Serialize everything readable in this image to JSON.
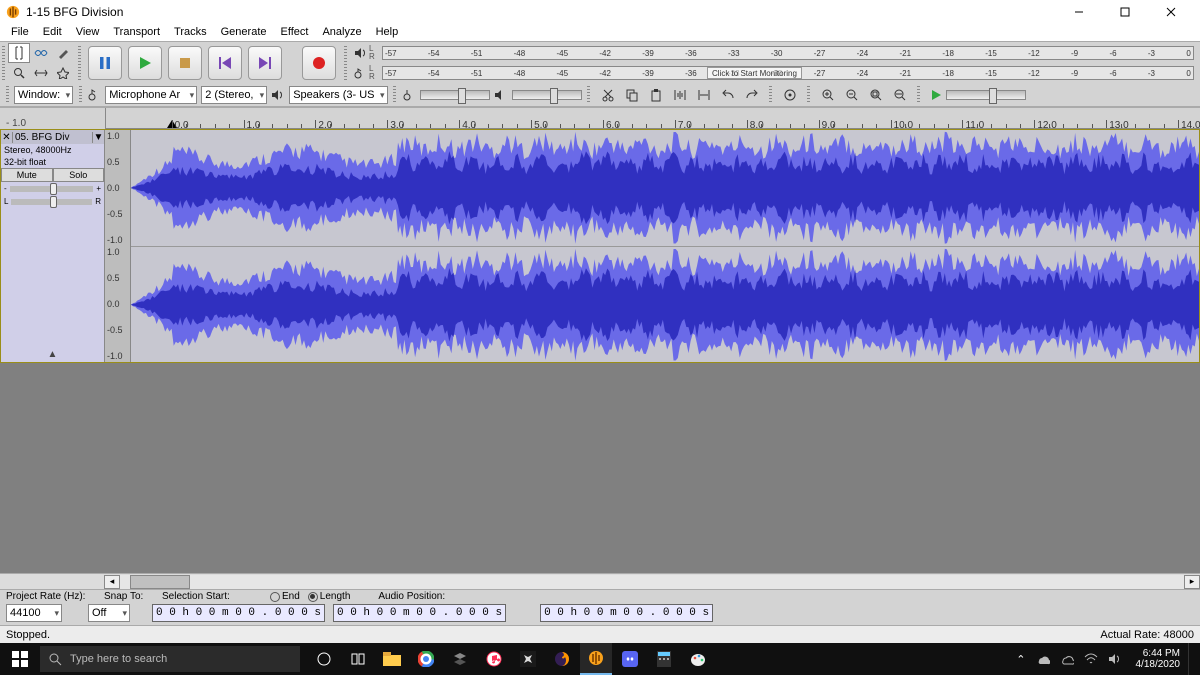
{
  "window": {
    "title": "1-15 BFG Division"
  },
  "menu": [
    "File",
    "Edit",
    "View",
    "Transport",
    "Tracks",
    "Generate",
    "Effect",
    "Analyze",
    "Help"
  ],
  "meter": {
    "ticks": [
      "-57",
      "-54",
      "-51",
      "-48",
      "-45",
      "-42",
      "-39",
      "-36",
      "-33",
      "-30",
      "-27",
      "-24",
      "-21",
      "-18",
      "-15",
      "-12",
      "-9",
      "-6",
      "-3",
      "0"
    ],
    "click_label": "Click to Start Monitoring"
  },
  "devices": {
    "host_label": "Window:",
    "host": "Window:",
    "rec": "Microphone Ar",
    "rec_chan": "2 (Stereo,",
    "play": "Speakers (3- US"
  },
  "ruler": {
    "pad_label": "- 1.0",
    "ticks": [
      "0.0",
      "1.0",
      "2.0",
      "3.0",
      "4.0",
      "5.0",
      "6.0",
      "7.0",
      "8.0",
      "9.0",
      "10.0",
      "11.0",
      "12.0",
      "13.0",
      "14.0"
    ]
  },
  "track": {
    "name": "05. BFG Div",
    "format_line1": "Stereo, 48000Hz",
    "format_line2": "32-bit float",
    "mute": "Mute",
    "solo": "Solo",
    "gain_minus": "-",
    "gain_plus": "+",
    "pan_l": "L",
    "pan_r": "R",
    "scale_top": "1.0",
    "scale_half": "0.5",
    "scale_zero": "0.0",
    "scale_nhalf": "-0.5",
    "scale_bot": "-1.0"
  },
  "selection": {
    "rate_label": "Project Rate (Hz):",
    "rate": "44100",
    "snap_label": "Snap To:",
    "snap": "Off",
    "start_label": "Selection Start:",
    "end_label": "End",
    "length_label": "Length",
    "pos_label": "Audio Position:",
    "time_zero": "0 0 h 0 0 m 0 0 . 0 0 0 s"
  },
  "status": {
    "left": "Stopped.",
    "right": "Actual Rate: 48000"
  },
  "taskbar": {
    "search_placeholder": "Type here to search",
    "time": "6:44 PM",
    "date": "4/18/2020"
  }
}
